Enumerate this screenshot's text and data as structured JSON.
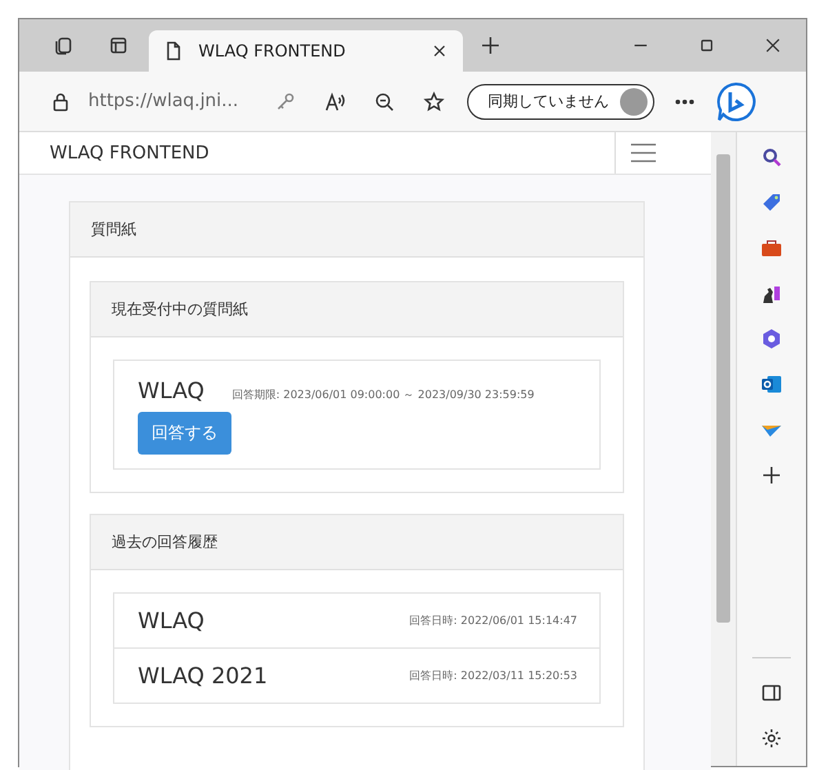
{
  "browser": {
    "tab_title": "WLAQ FRONTEND",
    "url": "https://wlaq.jni...",
    "sync_label": "同期していません"
  },
  "page": {
    "brand": "WLAQ FRONTEND",
    "card": {
      "title": "質問紙",
      "current": {
        "title": "現在受付中の質問紙",
        "items": [
          {
            "name": "WLAQ",
            "period": "回答期限: 2023/06/01 09:00:00 ～ 2023/09/30 23:59:59",
            "button": "回答する"
          }
        ]
      },
      "history": {
        "title": "過去の回答履歴",
        "items": [
          {
            "name": "WLAQ",
            "answered": "回答日時: 2022/06/01 15:14:47"
          },
          {
            "name": "WLAQ 2021",
            "answered": "回答日時: 2022/03/11 15:20:53"
          }
        ]
      }
    }
  }
}
